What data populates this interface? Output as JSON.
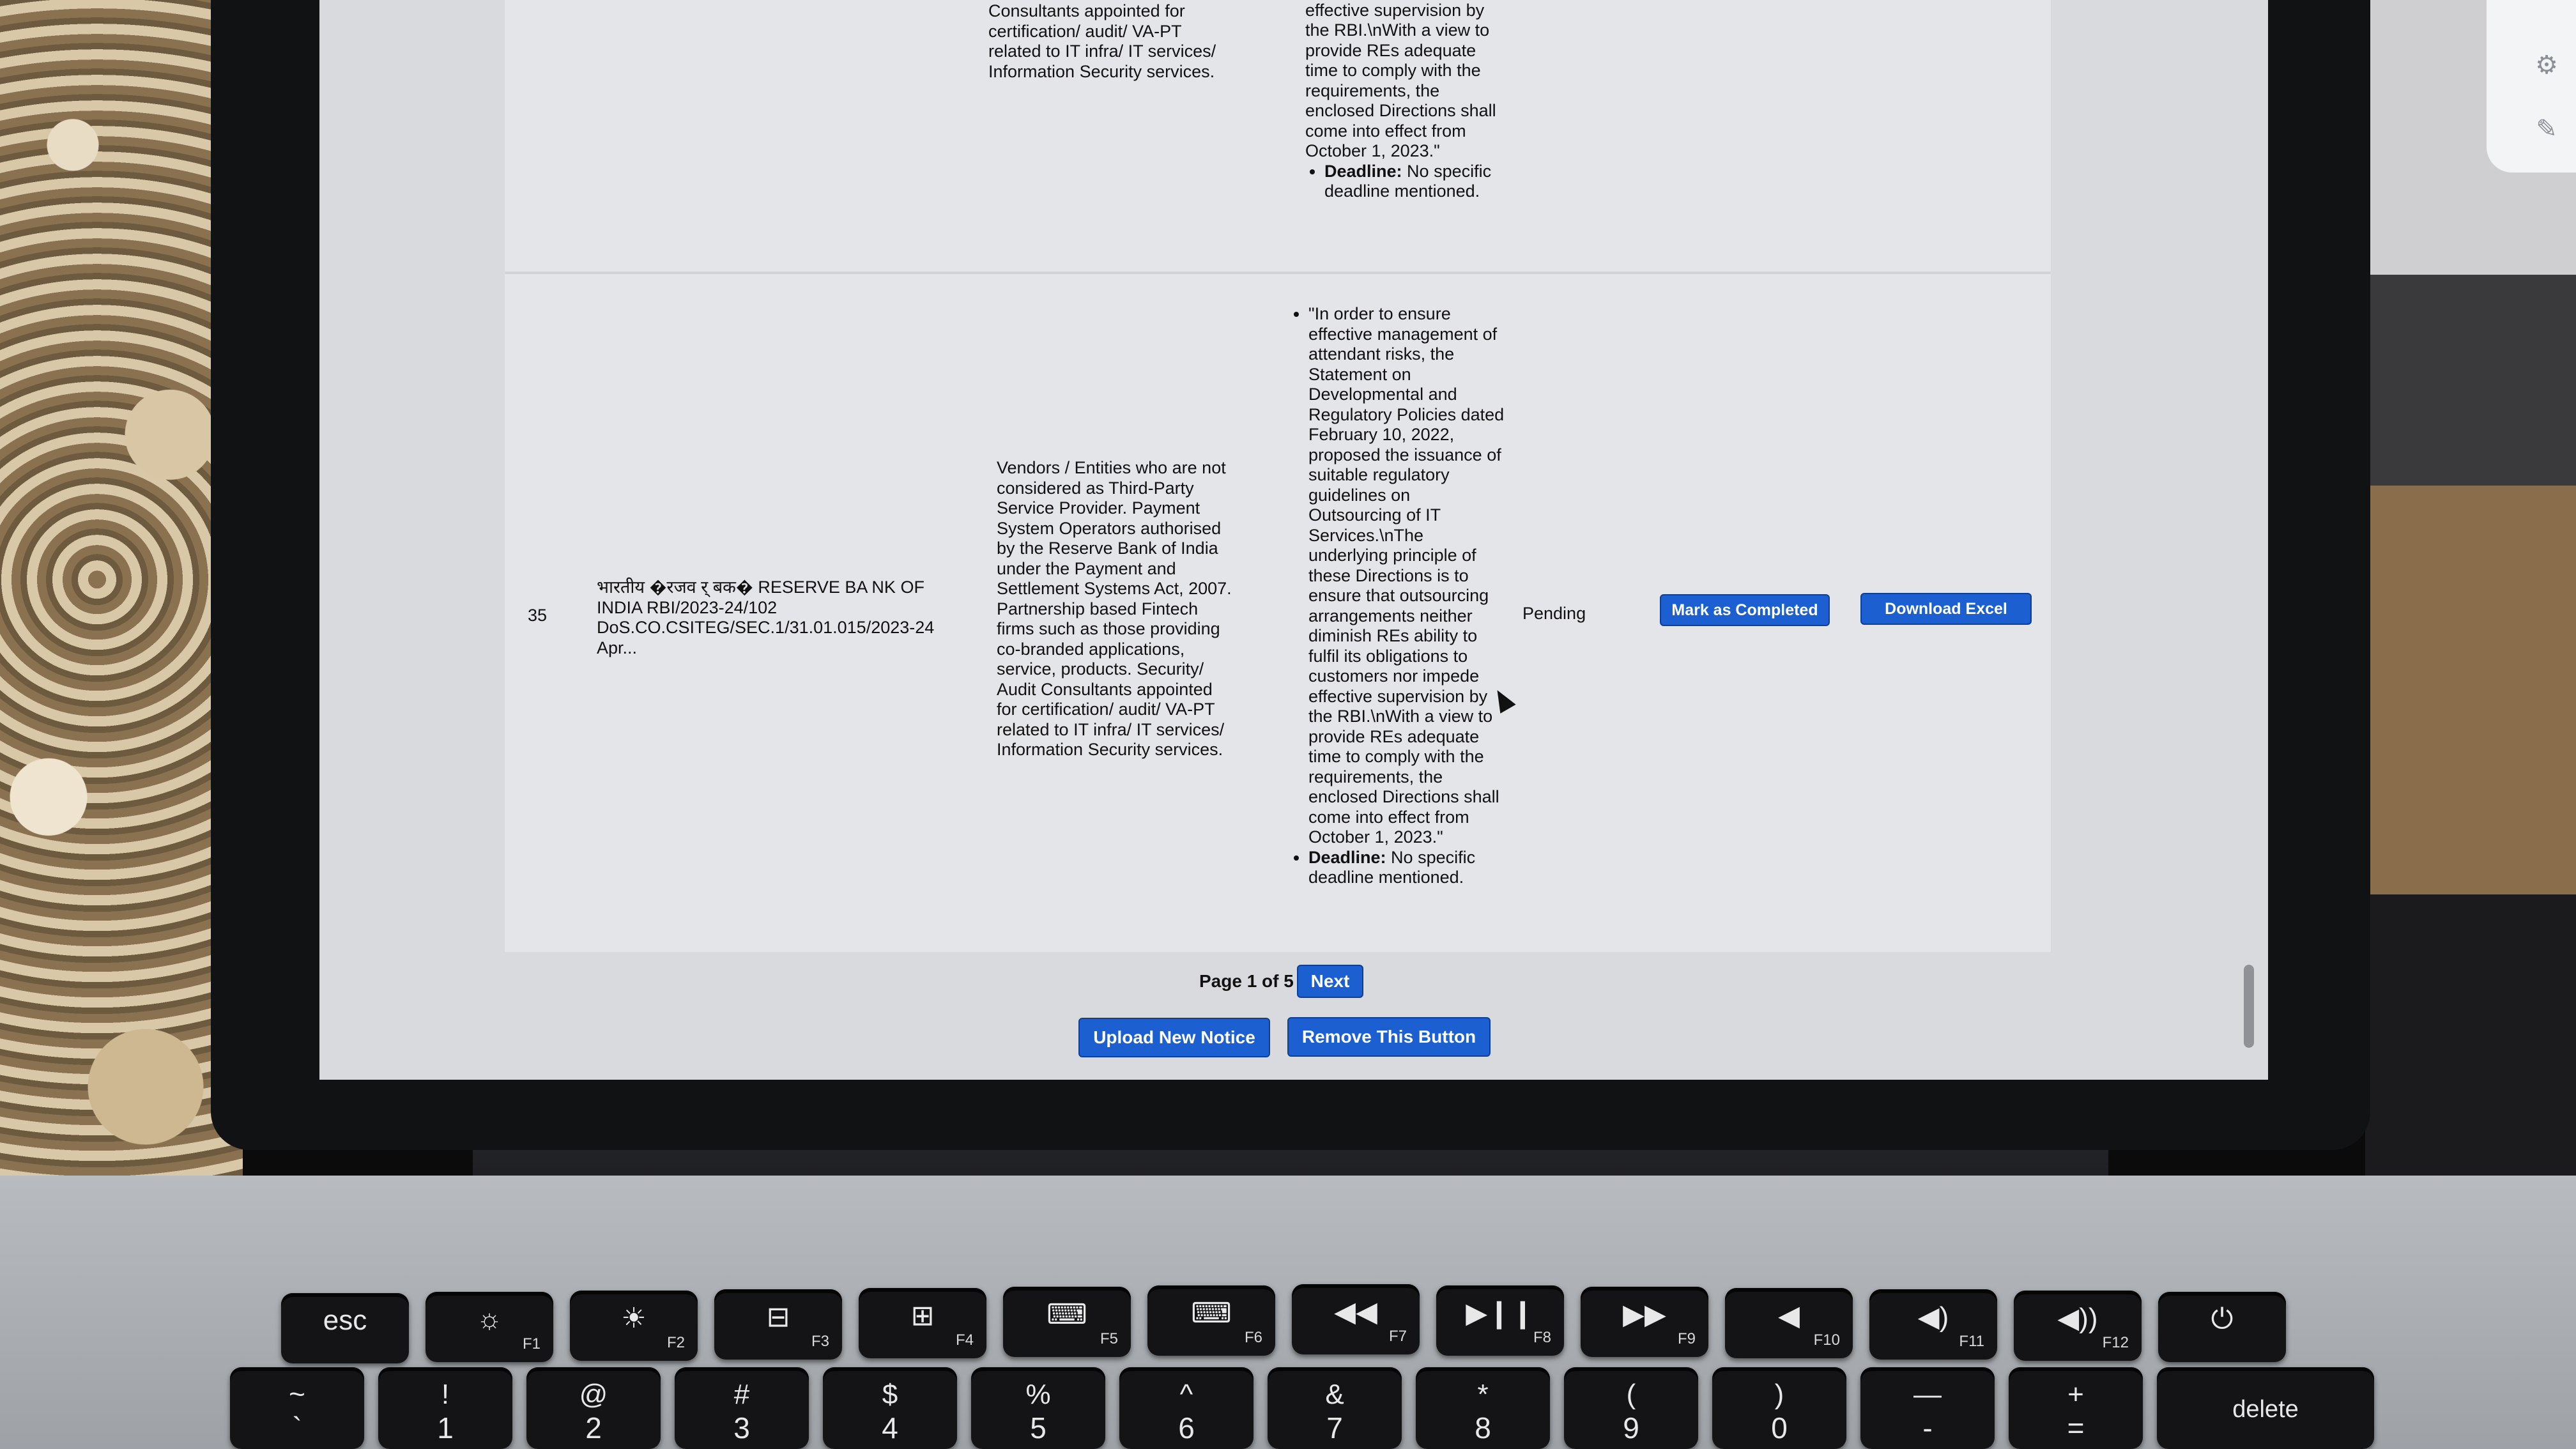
{
  "row_prev": {
    "applicability": "Consultants appointed for certification/ audit/ VA-PT related to IT infra/ IT services/ Information Security services.",
    "summary_text": "customers nor impede effective supervision by the RBI.\\nWith a view to provide REs adequate time to comply with the requirements, the enclosed Directions shall come into effect from October 1, 2023.\"",
    "deadline_label": "Deadline:",
    "deadline_value": "No specific deadline mentioned."
  },
  "row": {
    "number": "35",
    "notice": "भारतीय �रजव र् बक� RESERVE BA NK OF INDIA RBI/2023-24/102 DoS.CO.CSITEG/SEC.1/31.01.015/2023-24 Apr...",
    "applicability": "Vendors / Entities who are not considered as Third-Party Service Provider. Payment System Operators authorised by the Reserve Bank of India under the Payment and Settlement Systems Act, 2007. Partnership based Fintech firms such as those providing co-branded applications, service, products. Security/ Audit Consultants appointed for certification/ audit/ VA-PT related to IT infra/ IT services/ Information Security services.",
    "summary_text": "\"In order to ensure effective management of attendant risks, the Statement on Developmental and Regulatory Policies dated February 10, 2022, proposed the issuance of suitable regulatory guidelines on Outsourcing of IT Services.\\nThe underlying principle of these Directions is to ensure that outsourcing arrangements neither diminish REs ability to fulfil its obligations to customers nor impede effective supervision by the RBI.\\nWith a view to provide REs adequate time to comply with the requirements, the enclosed Directions shall come into effect from October 1, 2023.\"",
    "deadline_label": "Deadline:",
    "deadline_value": "No specific deadline mentioned.",
    "status": "Pending",
    "mark_button": "Mark as Completed",
    "download_button": "Download Excel"
  },
  "pagination": {
    "label": "Page 1 of 5",
    "next": "Next"
  },
  "actions": {
    "upload": "Upload New Notice",
    "remove": "Remove This Button"
  },
  "keyboard": {
    "fn_row": [
      {
        "main": "esc",
        "fn": ""
      },
      {
        "main": "☼",
        "fn": "F1"
      },
      {
        "main": "☀",
        "fn": "F2"
      },
      {
        "main": "⊟",
        "fn": "F3"
      },
      {
        "main": "⊞",
        "fn": "F4"
      },
      {
        "main": "⌨",
        "fn": "F5"
      },
      {
        "main": "⌨",
        "fn": "F6"
      },
      {
        "main": "◀◀",
        "fn": "F7"
      },
      {
        "main": "▶❙❙",
        "fn": "F8"
      },
      {
        "main": "▶▶",
        "fn": "F9"
      },
      {
        "main": "◀",
        "fn": "F10"
      },
      {
        "main": "◀)",
        "fn": "F11"
      },
      {
        "main": "◀))",
        "fn": "F12"
      },
      {
        "main": "⏻",
        "fn": ""
      }
    ],
    "num_row": [
      {
        "top": "~",
        "bottom": "`"
      },
      {
        "top": "!",
        "bottom": "1"
      },
      {
        "top": "@",
        "bottom": "2"
      },
      {
        "top": "#",
        "bottom": "3"
      },
      {
        "top": "$",
        "bottom": "4"
      },
      {
        "top": "%",
        "bottom": "5"
      },
      {
        "top": "^",
        "bottom": "6"
      },
      {
        "top": "&",
        "bottom": "7"
      },
      {
        "top": "*",
        "bottom": "8"
      },
      {
        "top": "(",
        "bottom": "9"
      },
      {
        "top": ")",
        "bottom": "0"
      },
      {
        "top": "—",
        "bottom": "-"
      },
      {
        "top": "+",
        "bottom": "="
      },
      {
        "top": "",
        "bottom": "delete"
      }
    ]
  }
}
